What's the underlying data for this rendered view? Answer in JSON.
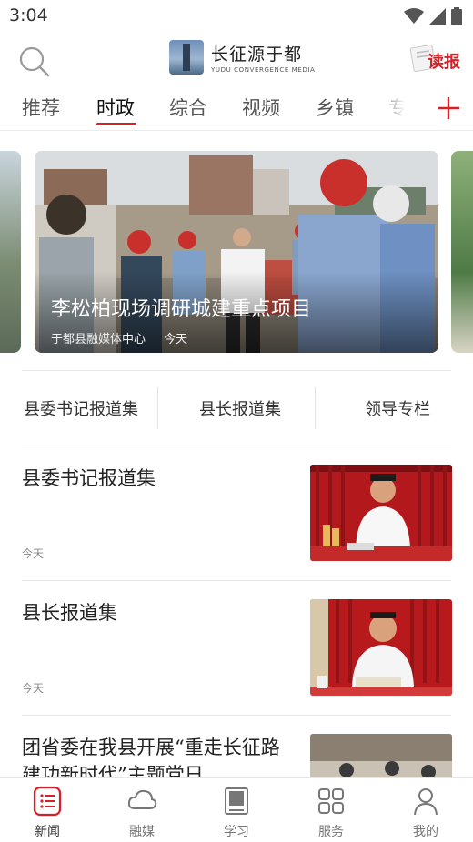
{
  "status_bar": {
    "time": "3:04"
  },
  "header": {
    "logo_title": "长征源于都",
    "logo_subtitle": "YUDU CONVERGENCE MEDIA",
    "read_paper_label": "读报"
  },
  "tabs": [
    {
      "label": "推荐"
    },
    {
      "label": "时政",
      "active": true
    },
    {
      "label": "综合"
    },
    {
      "label": "视频"
    },
    {
      "label": "乡镇"
    },
    {
      "label": "专"
    }
  ],
  "carousel": {
    "title": "李松柏现场调研城建重点项目",
    "source": "于都县融媒体中心",
    "time": "今天"
  },
  "columns": [
    {
      "label": "县委书记报道集"
    },
    {
      "label": "县长报道集"
    },
    {
      "label": "领导专栏"
    }
  ],
  "news": [
    {
      "title": "县委书记报道集",
      "time": "今天"
    },
    {
      "title": "县长报道集",
      "time": "今天"
    },
    {
      "title": "团省委在我县开展“重走长征路 建功新时代”主题党日…"
    }
  ],
  "bottom_nav": [
    {
      "label": "新闻",
      "icon": "news-list-icon",
      "active": true
    },
    {
      "label": "融媒",
      "icon": "cloud-icon"
    },
    {
      "label": "学习",
      "icon": "study-book-icon"
    },
    {
      "label": "服务",
      "icon": "grid-icon"
    },
    {
      "label": "我的",
      "icon": "person-icon"
    }
  ],
  "colors": {
    "accent": "#d61f26",
    "text": "#222222",
    "muted": "#888888"
  }
}
